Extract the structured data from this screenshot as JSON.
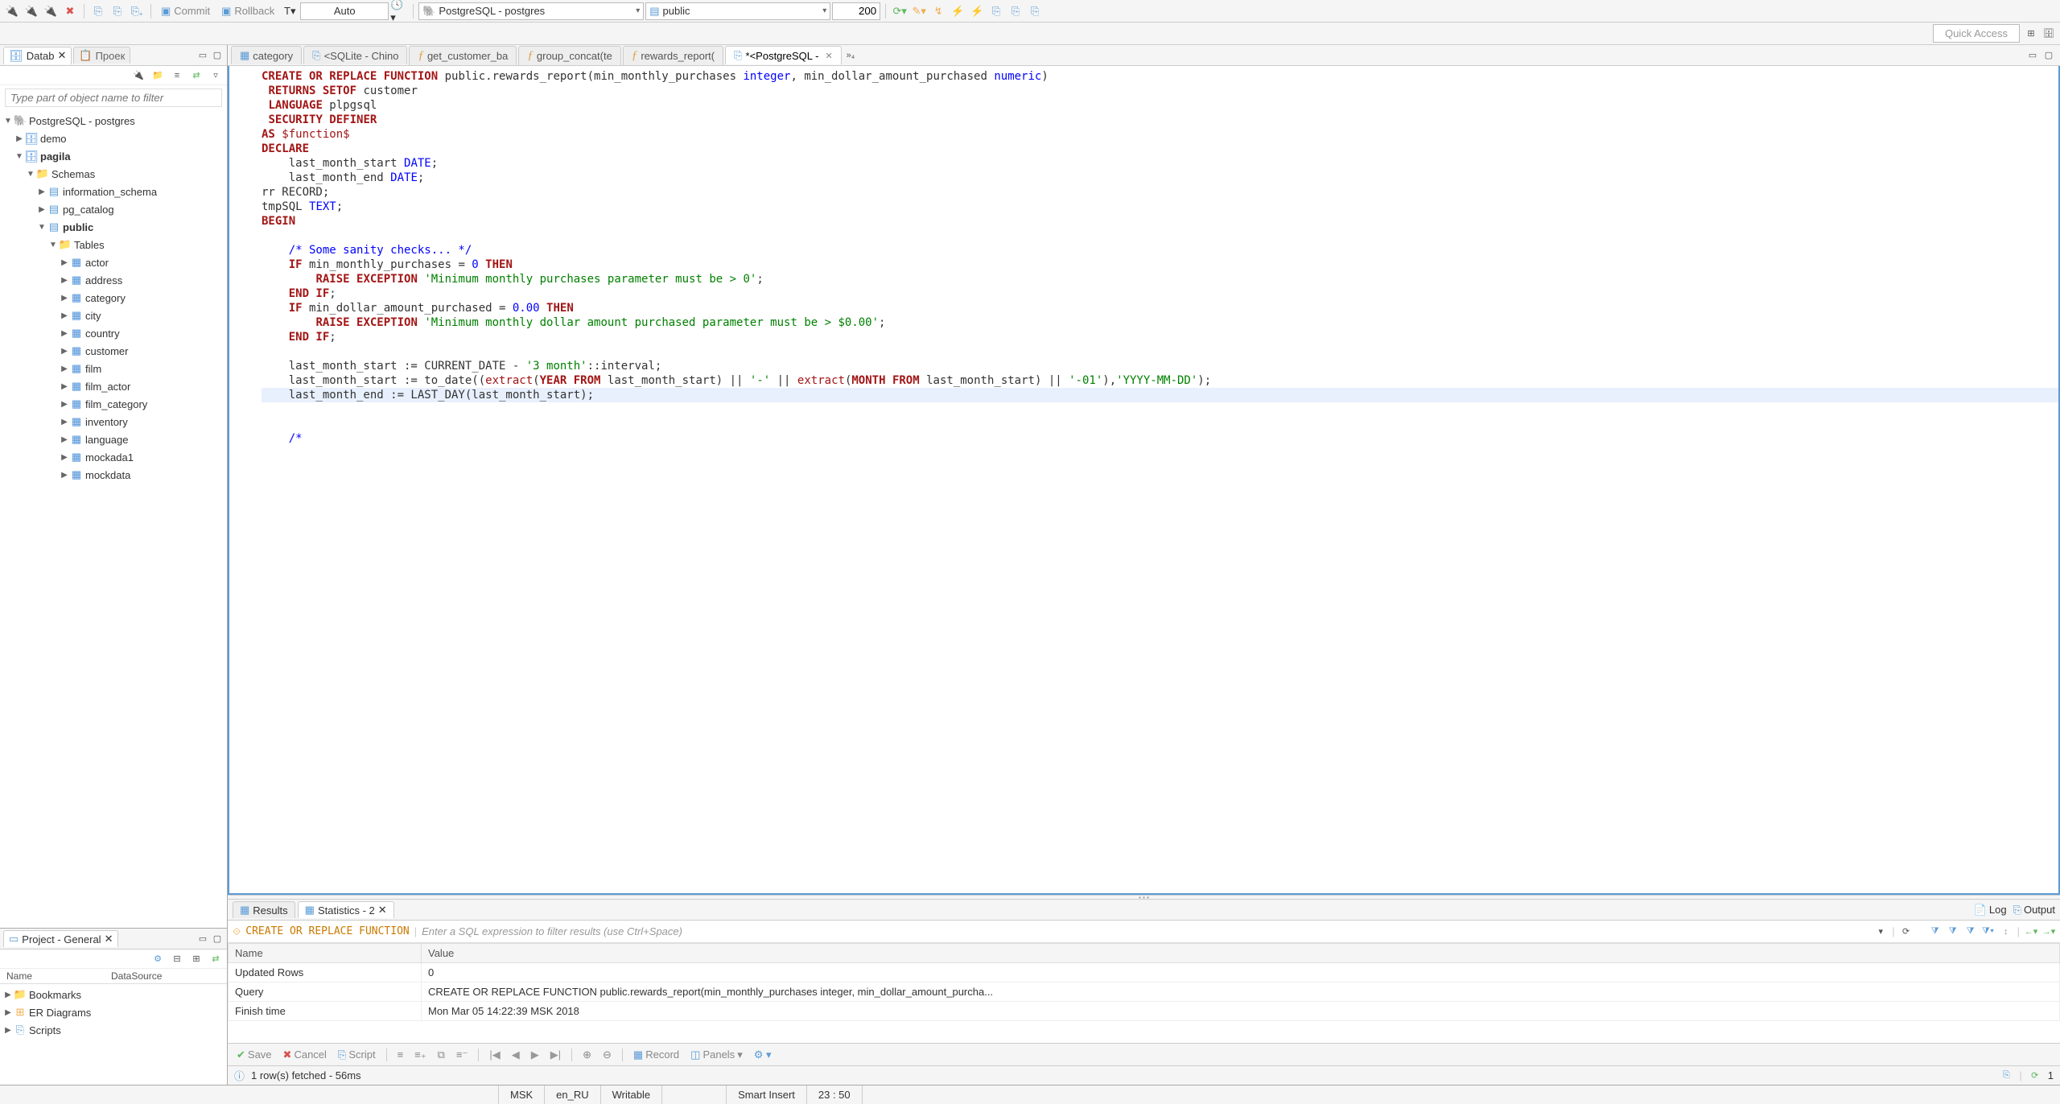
{
  "toolbar": {
    "commit": "Commit",
    "rollback": "Rollback",
    "auto": "Auto",
    "connection": "PostgreSQL - postgres",
    "schema": "public",
    "limit": "200"
  },
  "quickbar": {
    "quick_access": "Quick Access"
  },
  "left": {
    "tab_datab": "Datab",
    "tab_proek": "Проек",
    "filter_placeholder": "Type part of object name to filter",
    "tree": {
      "root": "PostgreSQL - postgres",
      "db_demo": "demo",
      "db_pagila": "pagila",
      "schemas": "Schemas",
      "info_schema": "information_schema",
      "pg_catalog": "pg_catalog",
      "public": "public",
      "tables": "Tables",
      "t_actor": "actor",
      "t_address": "address",
      "t_category": "category",
      "t_city": "city",
      "t_country": "country",
      "t_customer": "customer",
      "t_film": "film",
      "t_film_actor": "film_actor",
      "t_film_category": "film_category",
      "t_inventory": "inventory",
      "t_language": "language",
      "t_mockada1": "mockada1",
      "t_mockdata": "mockdata"
    },
    "project": {
      "title": "Project - General",
      "col_name": "Name",
      "col_ds": "DataSource",
      "bookmarks": "Bookmarks",
      "er": "ER Diagrams",
      "scripts": "Scripts"
    }
  },
  "editor_tabs": {
    "t1": "category",
    "t2": "<SQLite - Chino",
    "t3": "get_customer_ba",
    "t4": "group_concat(te",
    "t5": "rewards_report(",
    "t6": "*<PostgreSQL -",
    "more": "»₄"
  },
  "code_lines": [
    {
      "t": "<span class='kw'>CREATE OR REPLACE FUNCTION</span> public.rewards_report(min_monthly_purchases <span class='ty'>integer</span>, min_dollar_amount_purchased <span class='ty'>numeric</span>)"
    },
    {
      "t": " <span class='kw'>RETURNS SETOF</span> customer"
    },
    {
      "t": " <span class='kw'>LANGUAGE</span> plpgsql"
    },
    {
      "t": " <span class='kw'>SECURITY DEFINER</span>"
    },
    {
      "t": "<span class='kw'>AS</span> <span class='kw2'>$function$</span>"
    },
    {
      "t": "<span class='kw'>DECLARE</span>"
    },
    {
      "t": "    last_month_start <span class='ty'>DATE</span>;"
    },
    {
      "t": "    last_month_end <span class='ty'>DATE</span>;"
    },
    {
      "t": "rr RECORD;"
    },
    {
      "t": "tmpSQL <span class='ty'>TEXT</span>;"
    },
    {
      "t": "<span class='kw'>BEGIN</span>"
    },
    {
      "t": ""
    },
    {
      "t": "    <span class='cmt'>/* Some sanity checks... */</span>"
    },
    {
      "t": "    <span class='kw'>IF</span> min_monthly_purchases = <span class='num'>0</span> <span class='kw'>THEN</span>"
    },
    {
      "t": "        <span class='kw'>RAISE EXCEPTION</span> <span class='str'>'Minimum monthly purchases parameter must be &gt; 0'</span>;"
    },
    {
      "t": "    <span class='kw'>END IF</span>;"
    },
    {
      "t": "    <span class='kw'>IF</span> min_dollar_amount_purchased = <span class='num'>0.00</span> <span class='kw'>THEN</span>"
    },
    {
      "t": "        <span class='kw'>RAISE EXCEPTION</span> <span class='str'>'Minimum monthly dollar amount purchased parameter must be &gt; $0.00'</span>;"
    },
    {
      "t": "    <span class='kw'>END IF</span>;"
    },
    {
      "t": ""
    },
    {
      "t": "    last_month_start := CURRENT_DATE - <span class='str'>'3 month'</span>::interval;"
    },
    {
      "t": "    last_month_start := to_date((<span class='kw2'>extract</span>(<span class='kw'>YEAR FROM</span> last_month_start) || <span class='str'>'-'</span> || <span class='kw2'>extract</span>(<span class='kw'>MONTH FROM</span> last_month_start) || <span class='str'>'-01'</span>),<span class='str'>'YYYY-MM-DD'</span>);"
    },
    {
      "t": "    last_month_end := LAST_DAY(last_month_start);",
      "hl": true
    },
    {
      "t": ""
    },
    {
      "t": "    <span class='cmt'>/*</span>"
    }
  ],
  "results": {
    "tab_results": "Results",
    "tab_stats": "Statistics - 2",
    "log": "Log",
    "output": "Output",
    "sql_prefix": "CREATE OR REPLACE FUNCTION",
    "filter_hint": "Enter a SQL expression to filter results (use Ctrl+Space)",
    "col_name": "Name",
    "col_value": "Value",
    "rows": [
      {
        "n": "Updated Rows",
        "v": "0"
      },
      {
        "n": "Query",
        "v": "CREATE OR REPLACE FUNCTION public.rewards_report(min_monthly_purchases integer, min_dollar_amount_purcha..."
      },
      {
        "n": "Finish time",
        "v": "Mon Mar 05 14:22:39 MSK 2018"
      }
    ],
    "btn_save": "Save",
    "btn_cancel": "Cancel",
    "btn_script": "Script",
    "btn_record": "Record",
    "btn_panels": "Panels",
    "status": "1 row(s) fetched - 56ms",
    "page_num": "1"
  },
  "statusbar": {
    "tz": "MSK",
    "locale": "en_RU",
    "writable": "Writable",
    "insert": "Smart Insert",
    "pos": "23 : 50"
  }
}
